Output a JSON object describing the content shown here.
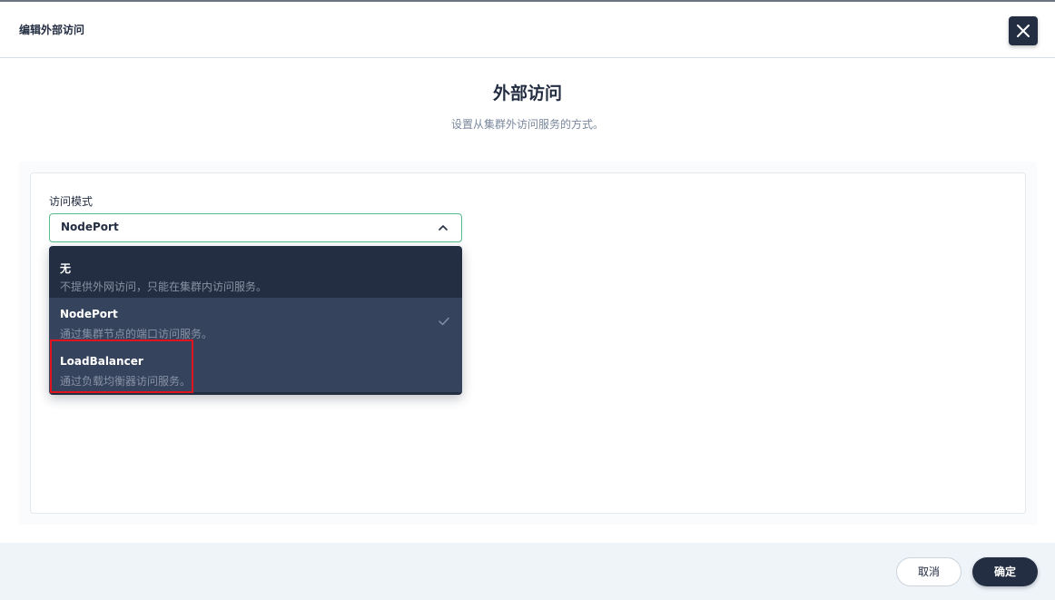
{
  "header": {
    "title": "编辑外部访问",
    "close_icon": "close-icon"
  },
  "main": {
    "title": "外部访问",
    "description": "设置从集群外访问服务的方式。"
  },
  "form": {
    "access_mode_label": "访问模式",
    "access_mode_value": "NodePort",
    "options": [
      {
        "title": "无",
        "description": "不提供外网访问，只能在集群内访问服务。"
      },
      {
        "title": "NodePort",
        "description": "通过集群节点的端口访问服务。",
        "selected": true
      },
      {
        "title": "LoadBalancer",
        "description": "通过负载均衡器访问服务。"
      }
    ]
  },
  "footer": {
    "cancel_label": "取消",
    "ok_label": "确定"
  },
  "colors": {
    "primary_dark": "#242e42",
    "accent_green": "#55bc8a",
    "highlight_red": "#e0141e"
  }
}
